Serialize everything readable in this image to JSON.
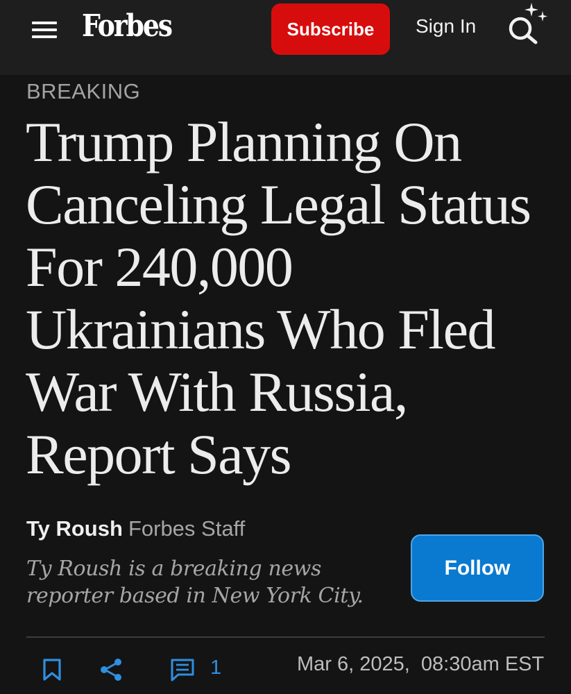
{
  "header": {
    "logo": "Forbes",
    "subscribe_label": "Subscribe",
    "signin_label": "Sign In",
    "icons": {
      "menu": "hamburger-menu-icon",
      "search": "search-sparkle-icon"
    },
    "colors": {
      "subscribe": "#d70d0d",
      "background": "#1e1e1e"
    }
  },
  "article": {
    "kicker": "BREAKING",
    "headline_lines": [
      "Trump Planning On",
      "Canceling Legal Status",
      "For 240,000",
      "Ukrainians Who Fled",
      "War With Russia,",
      "Report Says"
    ],
    "author": {
      "name": "Ty Roush",
      "role": "Forbes Staff",
      "bio_lines": [
        "Ty Roush is a breaking news",
        "reporter based in New York City."
      ],
      "follow_label": "Follow"
    },
    "toolbar": {
      "icons": [
        "bookmark-icon",
        "share-icon",
        "comment-icon"
      ],
      "comment_count": "1",
      "dateline": "Mar 6, 2025,  08:30am EST",
      "accent": "#2f8fe0"
    }
  }
}
